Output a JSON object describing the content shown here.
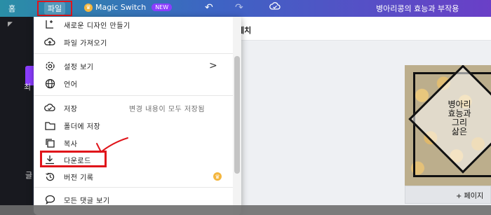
{
  "topbar": {
    "home_label": "홈",
    "file_label": "파일",
    "magic_label": "Magic Switch",
    "new_badge": "NEW",
    "doc_title": "병아리콩의 효능과 부작용"
  },
  "sidebar": {
    "label1": "최",
    "label2": "글"
  },
  "canvas": {
    "header_text": "페치",
    "thumbnail_text": [
      "병아리",
      "효능과 ",
      "그리",
      "삶은 "
    ],
    "add_page": "+ 페이지"
  },
  "menu": {
    "items": [
      {
        "label": "새로운 디자인 만들기",
        "icon": "new-design-icon"
      },
      {
        "label": "파일 가져오기",
        "icon": "cloud-upload-icon"
      },
      {
        "label": "설정 보기",
        "icon": "settings-icon",
        "chevron": ">"
      },
      {
        "label": "언어",
        "icon": "globe-icon"
      },
      {
        "label": "저장",
        "icon": "cloud-check-icon",
        "hint": "변경 내용이 모두 저장됨"
      },
      {
        "label": "폴더에 저장",
        "icon": "folder-icon"
      },
      {
        "label": "복사",
        "icon": "copy-icon"
      },
      {
        "label": "다운로드",
        "icon": "download-icon"
      },
      {
        "label": "버전 기록",
        "icon": "history-icon",
        "pro": true
      },
      {
        "label": "모든 댓글 보기",
        "icon": "comment-icon"
      }
    ]
  },
  "colors": {
    "highlight": "#e0141a",
    "brand_purple": "#8b3dff",
    "crown": "#f4b63e"
  }
}
